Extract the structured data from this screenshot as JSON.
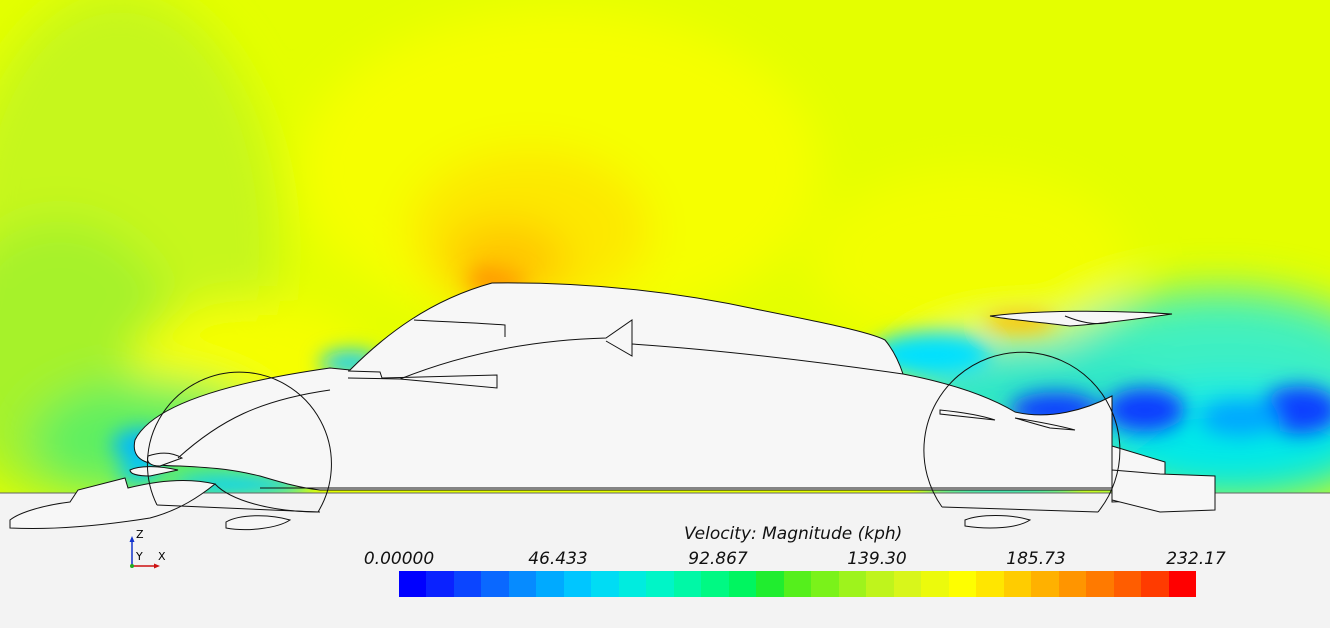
{
  "legend": {
    "title": "Velocity: Magnitude (kph)",
    "ticks": [
      "0.00000",
      "46.433",
      "92.867",
      "139.30",
      "185.73",
      "232.17"
    ],
    "range": [
      0,
      232.17
    ],
    "colormap": [
      "#0000ff",
      "#0a22ff",
      "#0b45ff",
      "#0a68ff",
      "#068bff",
      "#00aaff",
      "#00c6ff",
      "#00dcf4",
      "#00ecdf",
      "#00f5c7",
      "#00f8a6",
      "#00f983",
      "#00f560",
      "#20ed2f",
      "#55ef1c",
      "#7af21a",
      "#9ef31c",
      "#bff41c",
      "#d8f61b",
      "#ecfa0c",
      "#fefe00",
      "#ffe600",
      "#ffcc00",
      "#ffb100",
      "#ff9500",
      "#ff7a00",
      "#ff5d00",
      "#ff3b00",
      "#ff0000"
    ]
  },
  "axes_triad": {
    "z": "Z",
    "y": "Y",
    "x": "X"
  },
  "colors": {
    "freestream": "#e4ff00",
    "ground": "#f3f3f3",
    "body": "#f7f7f7",
    "outline": "#111111"
  }
}
